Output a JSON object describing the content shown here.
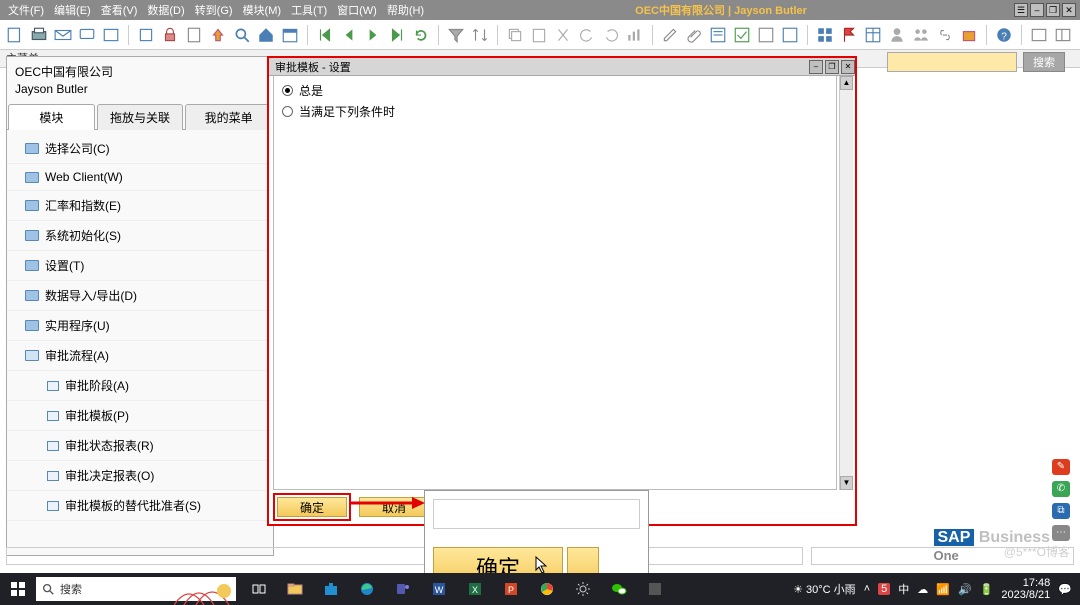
{
  "window": {
    "menus": [
      "文件(F)",
      "编辑(E)",
      "查看(V)",
      "数据(D)",
      "转到(G)",
      "模块(M)",
      "工具(T)",
      "窗口(W)",
      "帮助(H)"
    ],
    "title": "OEC中国有限公司  |  Jayson Butler",
    "controls": [
      "‒",
      "❐",
      "✕"
    ],
    "tray1": "☰",
    "tray2": "‒",
    "tray3": "❐",
    "tray4": "✕"
  },
  "crumb": "主菜单",
  "search": {
    "placeholder": "",
    "button": "搜索"
  },
  "sidebar": {
    "company": "OEC中国有限公司",
    "user": "Jayson Butler",
    "tabs": [
      "模块",
      "拖放与关联",
      "我的菜单"
    ],
    "active_tab": 0,
    "nodes": [
      {
        "label": "选择公司(C)",
        "type": "folder"
      },
      {
        "label": "Web Client(W)",
        "type": "folder"
      },
      {
        "label": "汇率和指数(E)",
        "type": "folder"
      },
      {
        "label": "系统初始化(S)",
        "type": "folder"
      },
      {
        "label": "设置(T)",
        "type": "folder"
      },
      {
        "label": "数据导入/导出(D)",
        "type": "folder"
      },
      {
        "label": "实用程序(U)",
        "type": "folder"
      },
      {
        "label": "审批流程(A)",
        "type": "folder_open"
      },
      {
        "label": "审批阶段(A)",
        "type": "leaf"
      },
      {
        "label": "审批模板(P)",
        "type": "leaf"
      },
      {
        "label": "审批状态报表(R)",
        "type": "leaf"
      },
      {
        "label": "审批决定报表(O)",
        "type": "leaf"
      },
      {
        "label": "审批模板的替代批准者(S)",
        "type": "leaf"
      }
    ]
  },
  "dialog": {
    "title": "审批模板 - 设置",
    "opt_always": "总是",
    "opt_cond": "当满足下列条件时",
    "selected": "always",
    "ok": "确定",
    "cancel": "取消",
    "win_controls": [
      "‒",
      "❐",
      "✕"
    ]
  },
  "inset": {
    "ok_big": "确定"
  },
  "logo": {
    "sap": "SAP",
    "bo": " Business",
    "one": "One"
  },
  "watermark": "@5***O博客",
  "taskbar": {
    "search_label": "搜索",
    "icons": [
      "task-view",
      "folder",
      "store",
      "edge",
      "teams",
      "word",
      "excel",
      "ppt",
      "chrome",
      "settings",
      "wechat",
      "unknown"
    ],
    "weather": "30°C 小雨",
    "ime": "中",
    "notif": "5",
    "time": "17:48",
    "date": "2023/8/21"
  },
  "colors": {
    "annot": "#e30000",
    "gold_top": "#ffe89a",
    "gold_bot": "#f3c95a"
  }
}
